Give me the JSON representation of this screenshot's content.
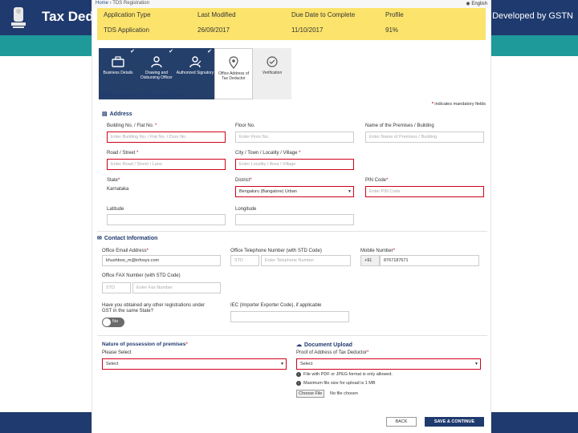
{
  "slide": {
    "title": "Tax Deductor",
    "developed_by": "Developed by GSTN"
  },
  "breadcrumb": {
    "home": "Home",
    "current": "TDS Registration",
    "language": "English"
  },
  "summary": {
    "headers": [
      "Application Type",
      "Last Modified",
      "Due Date to Complete",
      "Profile"
    ],
    "values": [
      "TDS Application",
      "26/09/2017",
      "11/10/2017",
      "91%"
    ]
  },
  "steps": [
    {
      "label": "Business Details",
      "icon": "briefcase-icon",
      "state": "done"
    },
    {
      "label": "Drawing and Disbursing Officer",
      "icon": "officer-icon",
      "state": "done"
    },
    {
      "label": "Authorized Signatory",
      "icon": "signatory-icon",
      "state": "done"
    },
    {
      "label": "Office Address of Tax Deductor",
      "icon": "location-pin-icon",
      "state": "active"
    },
    {
      "label": "Verification",
      "icon": "check-circle-icon",
      "state": "pending"
    }
  ],
  "page_title": "Office Address of Tax Deductor",
  "mandatory_note": "indicates mandatory fields",
  "address": {
    "section": "Address",
    "building_label": "Building No. / Flat No.",
    "building_ph": "Enter Building No. / Flat No. / Door No.",
    "floor_label": "Floor No.",
    "floor_ph": "Enter Floor No.",
    "premises_label": "Name of the Premises / Building",
    "premises_ph": "Enter Name of Premises / Building",
    "road_label": "Road / Street",
    "road_ph": "Enter Road / Street / Lane",
    "city_label": "City / Town / Locality / Village",
    "city_ph": "Enter Locality / Area / Village",
    "state_label": "State",
    "state_value": "Karnataka",
    "district_label": "District",
    "district_value": "Bengaluru (Bangalore) Urban",
    "pin_label": "PIN Code",
    "pin_ph": "Enter PIN Code",
    "latitude_label": "Latitude",
    "longitude_label": "Longitude"
  },
  "contact": {
    "section": "Contact Information",
    "email_label": "Office Email Address",
    "email_value": "khushboo_m@infosys.com",
    "tel_label": "Office Telephone Number (with STD Code)",
    "std_ph": "STD",
    "tel_ph": "Enter Telephone Number",
    "mobile_label": "Mobile Number",
    "mobile_prefix": "+91",
    "mobile_value": "8767187671",
    "fax_label": "Office FAX Number (with STD Code)",
    "fax_std_ph": "STD",
    "fax_ph": "Enter Fax Number"
  },
  "other_reg": {
    "question": "Have you obtained any other registrations under GST in the same State?",
    "toggle_value": "No",
    "iec_label": "IEC (Importer Exporter Code), if applicable"
  },
  "premises": {
    "label": "Nature of possession of premises",
    "sub_label": "Please Select",
    "select_value": "Select"
  },
  "upload": {
    "section": "Document Upload",
    "proof_label": "Proof of Address of Tax Deductor",
    "select_value": "Select",
    "note1": "File with PDF or JPEG format is only allowed.",
    "note2": "Maximum file size for upload is 1 MB",
    "choose_file": "Choose File",
    "no_file": "No file chosen"
  },
  "buttons": {
    "back": "BACK",
    "save": "SAVE & CONTINUE"
  },
  "colors": {
    "navy": "#1f3a6e",
    "teal": "#1f9a9a",
    "yellow": "#fce46c",
    "error": "#d0021b"
  }
}
